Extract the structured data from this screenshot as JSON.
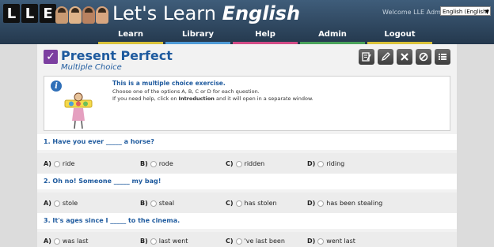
{
  "header": {
    "logo_letters": [
      "L",
      "L",
      "E"
    ],
    "title_plain": "Let's Learn ",
    "title_emph": "English",
    "welcome": "Welcome LLE Admin",
    "language": "English (English)"
  },
  "nav": [
    "Learn",
    "Library",
    "Help",
    "Admin",
    "Logout"
  ],
  "exercise": {
    "title": "Present Perfect",
    "subtitle": "Multiple Choice",
    "tools": [
      "notes-icon",
      "pencil-icon",
      "close-icon",
      "cancel-icon",
      "list-icon"
    ]
  },
  "info": {
    "heading": "This is a multiple choice exercise.",
    "line1": "Choose one of the options A, B, C or D for each question.",
    "line2_pre": "If you need help, click on ",
    "line2_link": "Introduction",
    "line2_post": " and it will open in a separate window."
  },
  "questions": [
    {
      "text": "1. Have you ever _____ a horse?",
      "options": [
        {
          "letter": "A)",
          "text": "ride"
        },
        {
          "letter": "B)",
          "text": "rode"
        },
        {
          "letter": "C)",
          "text": "ridden"
        },
        {
          "letter": "D)",
          "text": "riding"
        }
      ]
    },
    {
      "text": "2. Oh no! Someone _____ my bag!",
      "options": [
        {
          "letter": "A)",
          "text": "stole"
        },
        {
          "letter": "B)",
          "text": "steal"
        },
        {
          "letter": "C)",
          "text": "has stolen"
        },
        {
          "letter": "D)",
          "text": "has been stealing"
        }
      ]
    },
    {
      "text": "3. It's ages since I _____ to the cinema.",
      "options": [
        {
          "letter": "A)",
          "text": "was last"
        },
        {
          "letter": "B)",
          "text": "last went"
        },
        {
          "letter": "C)",
          "text": "'ve last been"
        },
        {
          "letter": "D)",
          "text": "went last"
        }
      ]
    }
  ]
}
